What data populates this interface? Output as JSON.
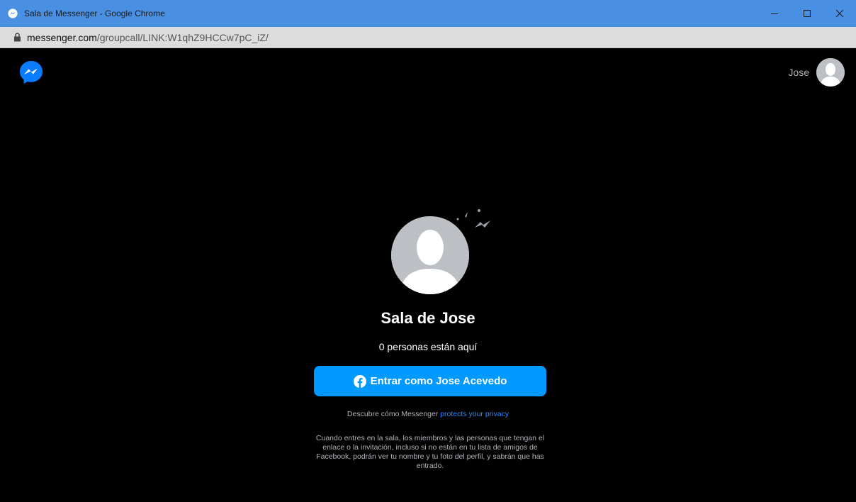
{
  "window": {
    "title": "Sala de Messenger - Google Chrome",
    "controls": {
      "minimize": "minimize-icon",
      "maximize": "maximize-icon",
      "close": "close-icon"
    }
  },
  "address": {
    "host": "messenger.com",
    "path": "/groupcall/LINK:W1qhZ9HCCw7pC_iZ/"
  },
  "header": {
    "user_name": "Jose"
  },
  "room": {
    "title": "Sala de Jose",
    "count": "0 personas están aquí",
    "join_label": "Entrar como Jose Acevedo"
  },
  "privacy": {
    "text": "Descubre cómo Messenger ",
    "link": "protects your privacy"
  },
  "disclaimer": "Cuando entres en la sala, los miembros y las personas que tengan el enlace o la invitación, incluso si no están en tu lista de amigos de Facebook, podrán ver tu nombre y tu foto del perfil, y sabrán que has entrado.",
  "colors": {
    "titlebar": "#4a90e2",
    "accent": "#0099ff",
    "link": "#2d88ff",
    "background": "#000000"
  }
}
